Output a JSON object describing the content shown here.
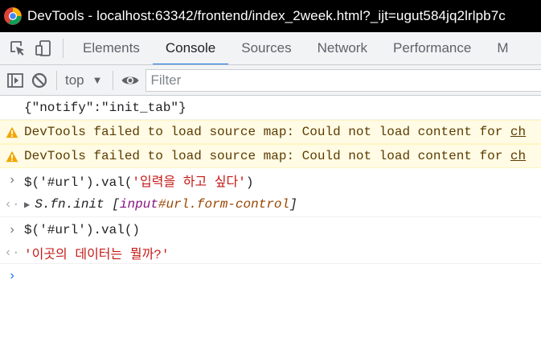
{
  "window": {
    "title": "DevTools - localhost:63342/frontend/index_2week.html?_ijt=ugut584jq2lrlpb7c"
  },
  "tabs": [
    {
      "label": "Elements"
    },
    {
      "label": "Console"
    },
    {
      "label": "Sources"
    },
    {
      "label": "Network"
    },
    {
      "label": "Performance"
    },
    {
      "label": "M"
    }
  ],
  "toolbar": {
    "context": "top",
    "filter_placeholder": "Filter"
  },
  "console": {
    "log1": "{\"notify\":\"init_tab\"}",
    "warn1": {
      "text": "DevTools failed to load source map: Could not load content for ",
      "link": "ch"
    },
    "warn2": {
      "text": "DevTools failed to load source map: Could not load content for ",
      "link": "ch"
    },
    "cmd1": {
      "prefix": "$('#url').val(",
      "arg": "'입력을 하고 싶다'",
      "suffix": ")"
    },
    "res1": {
      "fn": "S.fn.init",
      "open": "[",
      "tag": "input",
      "attr": "#url",
      "cls": ".form-control",
      "close": "]"
    },
    "cmd2": "$('#url').val()",
    "res2": "'이곳의 데이터는 뭘까?'"
  },
  "colors": {
    "accent": "#1a73e8",
    "warning_bg": "#fffbe5",
    "warning_icon": "#f2a600",
    "string": "#c41a16"
  }
}
